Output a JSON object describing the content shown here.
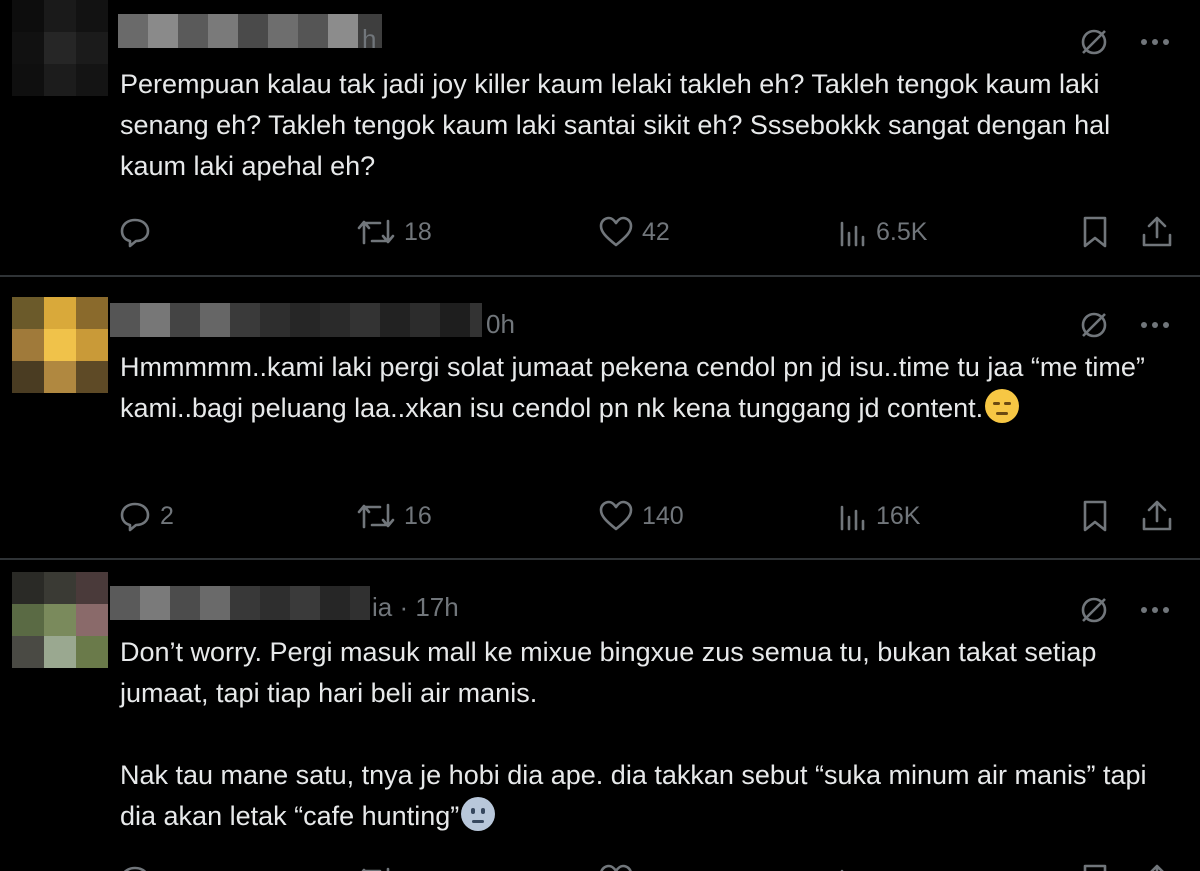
{
  "tweets": [
    {
      "time": "h",
      "text": "Perempuan kalau tak jadi joy killer kaum lelaki takleh eh? Takleh tengok kaum laki senang eh? Takleh tengok kaum laki santai sikit eh? Sssebokkk sangat dengan hal kaum laki apehal eh?",
      "reply_count": "",
      "retweet_count": "18",
      "like_count": "42",
      "view_count": "6.5K",
      "avatar_colors": [
        "#0d0d0d",
        "#1a1a1a",
        "#121212",
        "#111111",
        "#262626",
        "#1b1b1b",
        "#0f0f0f",
        "#1c1c1c",
        "#141414"
      ]
    },
    {
      "time": "0h",
      "text": "Hmmmmm..kami laki pergi solat jumaat pekena cendol pn jd isu..time tu jaa “me time” kami..bagi peluang laa..xkan isu cendol pn nk kena tunggang jd content.",
      "emoji": "relieved-face-emoji",
      "reply_count": "2",
      "retweet_count": "16",
      "like_count": "140",
      "view_count": "16K",
      "avatar_colors": [
        "#6b5a2a",
        "#d9a93a",
        "#8a6a2c",
        "#a07a3a",
        "#f0c24a",
        "#c99a38",
        "#4a3c22",
        "#b08840",
        "#5e4a26"
      ]
    },
    {
      "time": "ia · 17h",
      "text": "Don’t worry. Pergi masuk mall ke mixue bingxue zus semua tu, bukan takat setiap jumaat, tapi tiap hari beli air manis.\n\nNak tau mane satu, tnya je hobi dia ape. dia takkan sebut “suka minum air manis” tapi dia akan letak “cafe hunting”",
      "emoji": "neutral-face-emoji",
      "reply_count": "",
      "retweet_count": "",
      "like_count": "",
      "view_count": "",
      "avatar_colors": [
        "#2a2a26",
        "#3a3a34",
        "#4a3a3a",
        "#5a6a44",
        "#7a8a5c",
        "#8a6a6a",
        "#4a4a44",
        "#9aa890",
        "#6a7a4a"
      ]
    }
  ],
  "colors": {
    "background": "#000000",
    "text": "#e7e9ea",
    "muted": "#71767b",
    "divider": "#2f3336"
  },
  "icons": [
    "grok-icon",
    "more-icon",
    "reply-icon",
    "retweet-icon",
    "like-icon",
    "views-icon",
    "bookmark-icon",
    "share-icon"
  ]
}
